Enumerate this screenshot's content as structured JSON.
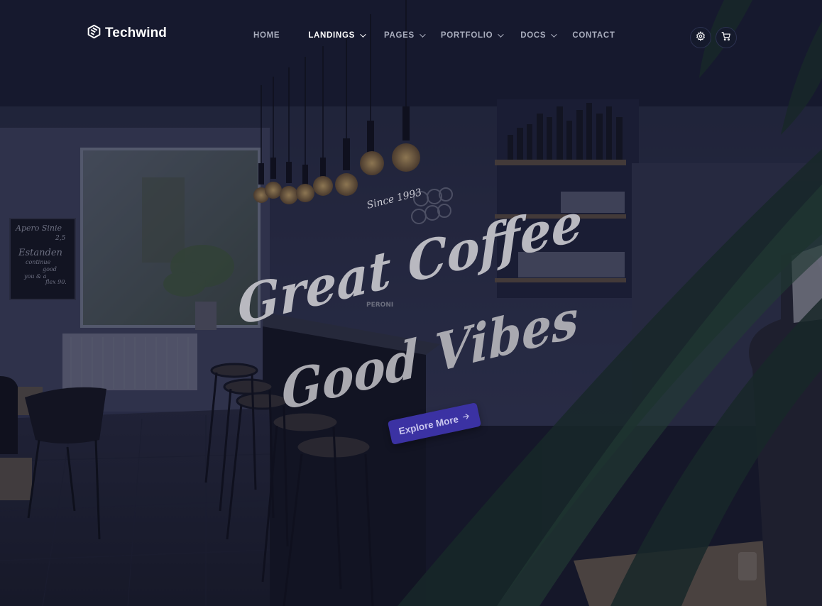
{
  "brand": {
    "name": "Techwind"
  },
  "nav": {
    "items": [
      {
        "label": "HOME",
        "has_dropdown": false,
        "active": false
      },
      {
        "label": "LANDINGS",
        "has_dropdown": true,
        "active": true
      },
      {
        "label": "PAGES",
        "has_dropdown": true,
        "active": false
      },
      {
        "label": "PORTFOLIO",
        "has_dropdown": true,
        "active": false
      },
      {
        "label": "DOCS",
        "has_dropdown": true,
        "active": false
      },
      {
        "label": "CONTACT",
        "has_dropdown": false,
        "active": false
      }
    ],
    "icons": [
      "gear-icon",
      "cart-icon"
    ]
  },
  "hero": {
    "tagline": "Since 1993",
    "headline_line1": "Great Coffee",
    "headline_line2": "Good Vibes",
    "cta_label": "Explore More",
    "cta_icon": "arrow-right-icon"
  },
  "background": {
    "chalkboard_lines": [
      "Apero Sinie",
      "2,5",
      "Estanden",
      "continue",
      "good",
      "you & a",
      "flex 90."
    ],
    "bottle_label": "PERONI"
  },
  "colors": {
    "cta_background": "#3b32a3",
    "overlay": "#0f1226",
    "nav_active": "#ffffff",
    "nav_inactive": "#a9adbd"
  }
}
